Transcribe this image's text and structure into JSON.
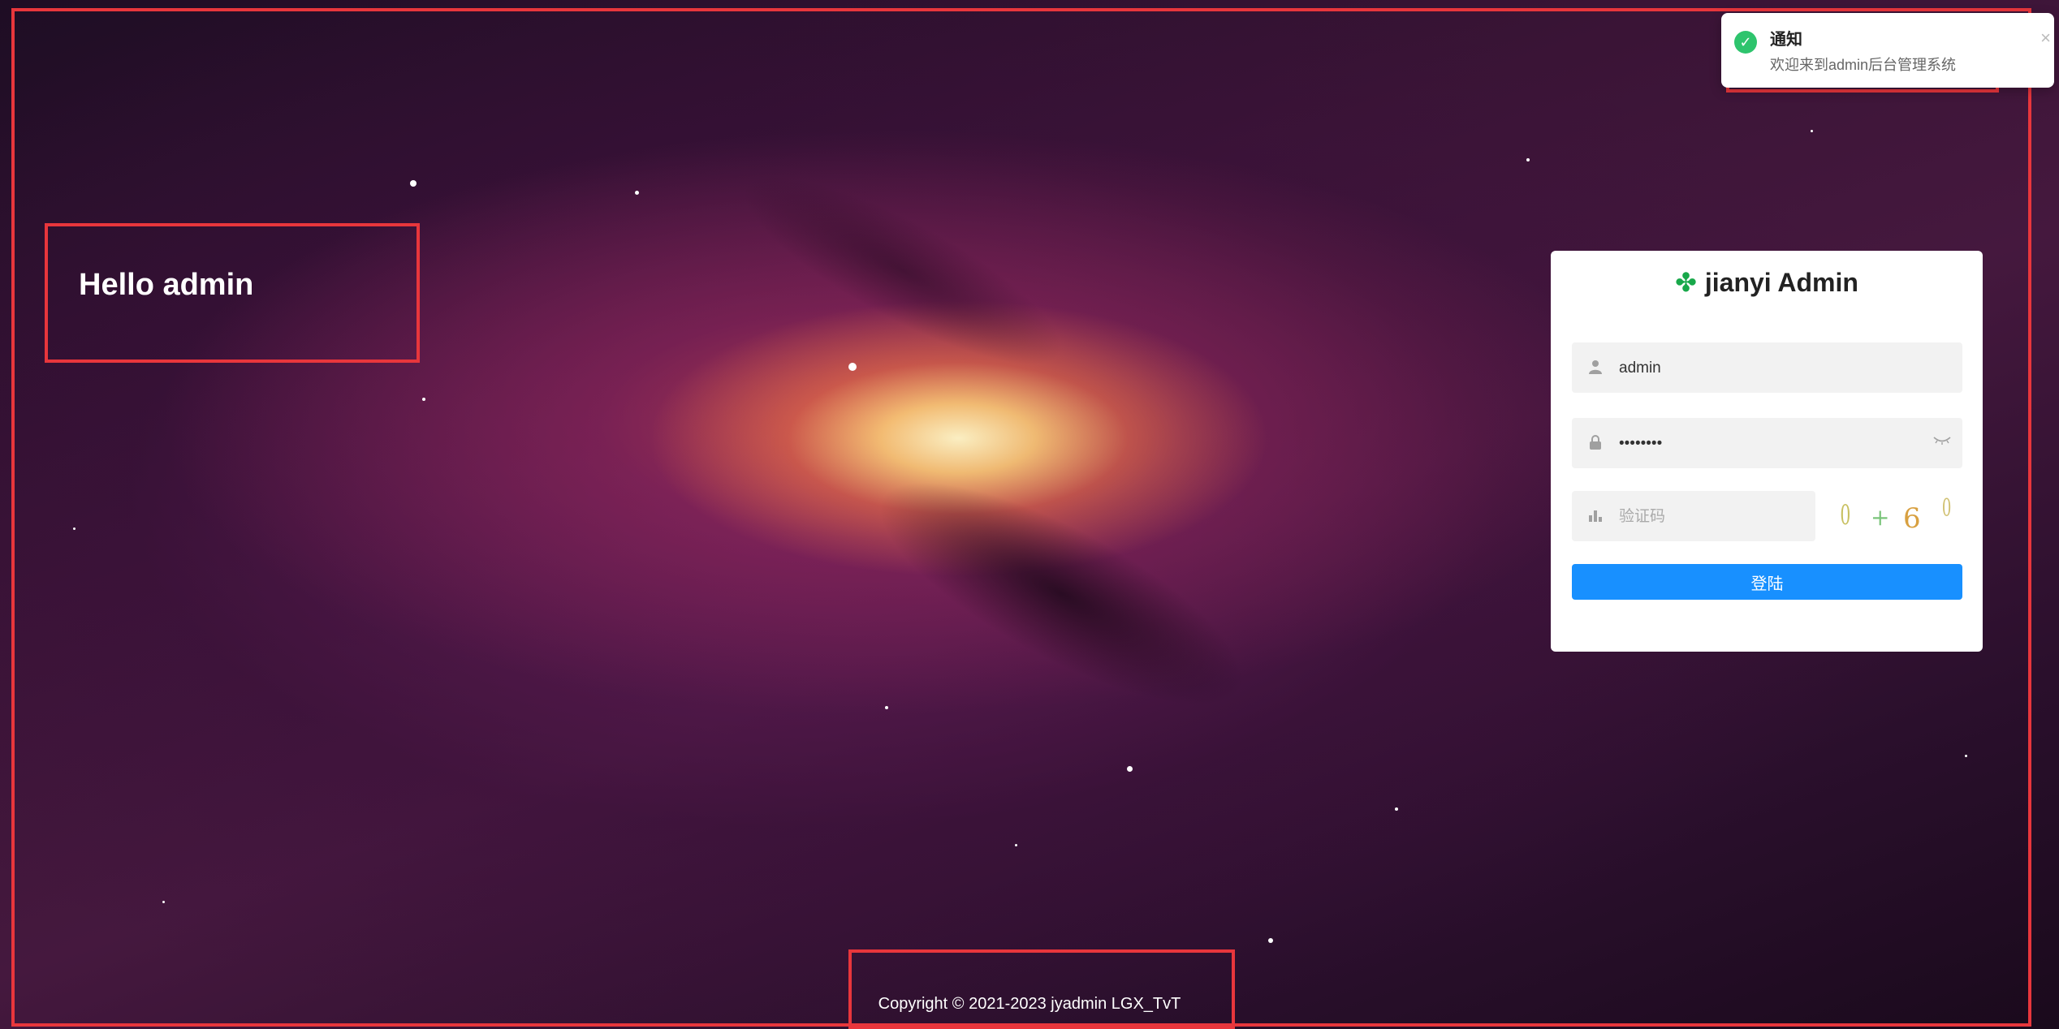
{
  "greeting": "Hello admin",
  "notification": {
    "title": "通知",
    "message": "欢迎来到admin后台管理系统",
    "icon": "check-circle-icon",
    "color": "#2ec46d"
  },
  "login": {
    "brand": "jianyi Admin",
    "brand_icon": "clover-icon",
    "username": {
      "value": "admin",
      "icon": "user-icon"
    },
    "password": {
      "value": "••••••••",
      "icon": "lock-icon",
      "toggle_icon": "eye-closed-icon"
    },
    "captcha": {
      "placeholder": "验证码",
      "icon": "bar-chart-icon",
      "image_text": "0 + 6 0"
    },
    "submit_label": "登陆",
    "accent_color": "#1890ff"
  },
  "footer": {
    "copyright": "Copyright © 2021-2023 jyadmin LGX_TvT"
  }
}
